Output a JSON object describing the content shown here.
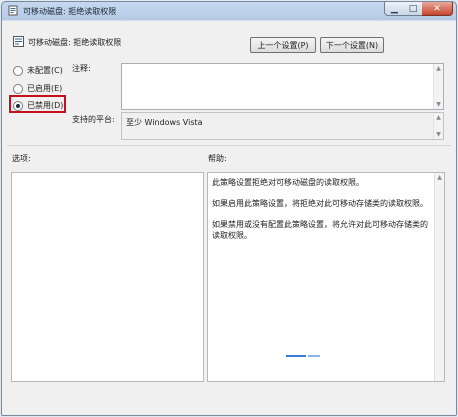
{
  "window": {
    "title": "可移动磁盘: 拒绝读取权限",
    "controls": {
      "minimize_icon": "minimize-icon",
      "maximize_icon": "maximize-icon",
      "close_icon": "close-icon"
    }
  },
  "header": {
    "policy_title": "可移动磁盘: 拒绝读取权限",
    "prev_button": "上一个设置(P)",
    "next_button": "下一个设置(N)"
  },
  "radios": [
    {
      "label": "未配置(C)",
      "checked": false
    },
    {
      "label": "已启用(E)",
      "checked": false
    },
    {
      "label": "已禁用(D)",
      "checked": true
    }
  ],
  "comment": {
    "label": "注释:",
    "value": ""
  },
  "platform": {
    "label": "支持的平台:",
    "value": "至少 Windows Vista"
  },
  "options": {
    "label": "选项:"
  },
  "help": {
    "label": "帮助:",
    "paragraphs": [
      "此策略设置拒绝对可移动磁盘的读取权限。",
      "如果启用此策略设置，将拒绝对此可移动存储类的读取权限。",
      "如果禁用或没有配置此策略设置，将允许对此可移动存储类的读取权限。"
    ]
  },
  "colors": {
    "highlight": "#c4121c",
    "title_bar": "#c5d8ee",
    "panel": "#f0f0f0"
  }
}
